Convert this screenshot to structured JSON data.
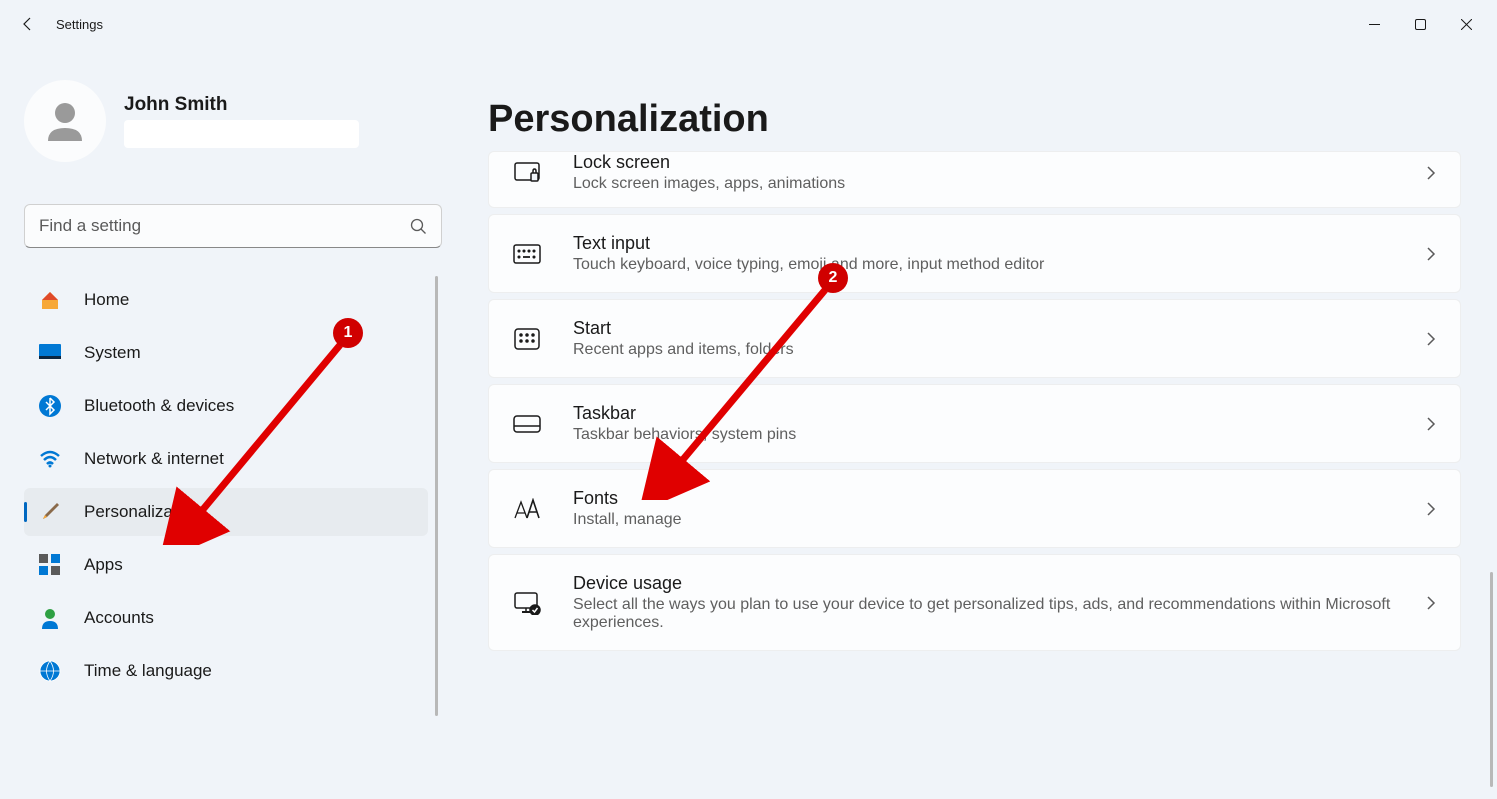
{
  "app": {
    "title": "Settings"
  },
  "user": {
    "name": "John Smith"
  },
  "search": {
    "placeholder": "Find a setting"
  },
  "nav": {
    "items": [
      {
        "label": "Home"
      },
      {
        "label": "System"
      },
      {
        "label": "Bluetooth & devices"
      },
      {
        "label": "Network & internet"
      },
      {
        "label": "Personalization"
      },
      {
        "label": "Apps"
      },
      {
        "label": "Accounts"
      },
      {
        "label": "Time & language"
      }
    ]
  },
  "page": {
    "title": "Personalization"
  },
  "cards": [
    {
      "title": "Lock screen",
      "desc": "Lock screen images, apps, animations"
    },
    {
      "title": "Text input",
      "desc": "Touch keyboard, voice typing, emoji and more, input method editor"
    },
    {
      "title": "Start",
      "desc": "Recent apps and items, folders"
    },
    {
      "title": "Taskbar",
      "desc": "Taskbar behaviors, system pins"
    },
    {
      "title": "Fonts",
      "desc": "Install, manage"
    },
    {
      "title": "Device usage",
      "desc": "Select all the ways you plan to use your device to get personalized tips, ads, and recommendations within Microsoft experiences."
    }
  ],
  "annotations": [
    {
      "n": "1"
    },
    {
      "n": "2"
    }
  ]
}
